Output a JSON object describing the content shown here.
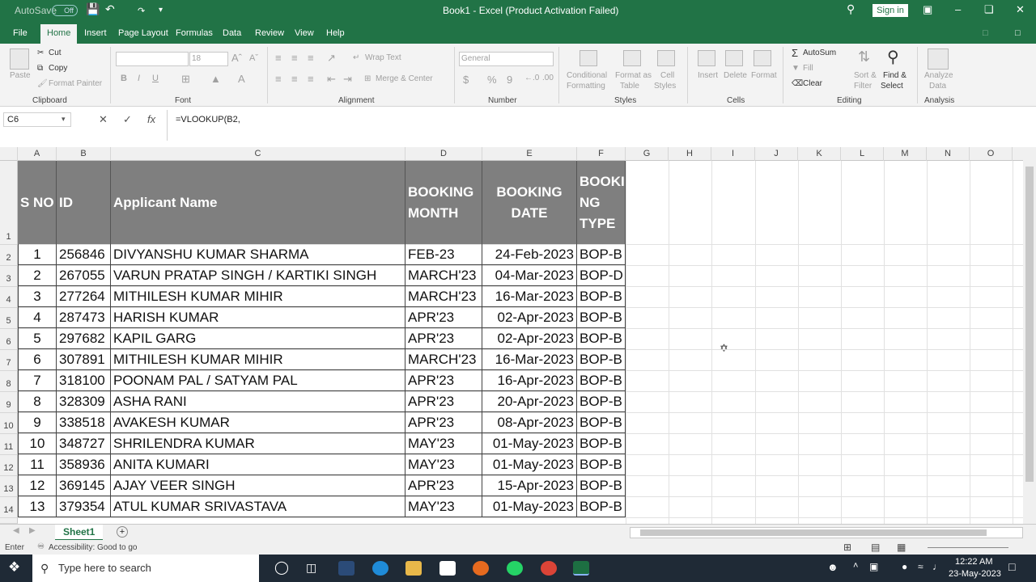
{
  "titlebar": {
    "autosave": "AutoSave",
    "autosave_state": "Off",
    "title": "Book1 - Excel (Product Activation Failed)",
    "sign_in": "Sign in"
  },
  "tabs": [
    "File",
    "Home",
    "Insert",
    "Page Layout",
    "Formulas",
    "Data",
    "Review",
    "View",
    "Help"
  ],
  "ribbon": {
    "clipboard": {
      "paste": "Paste",
      "cut": "Cut",
      "copy": "Copy",
      "format_painter": "Format Painter",
      "label": "Clipboard"
    },
    "font": {
      "name": "",
      "size": "18",
      "bold": "B",
      "italic": "I",
      "underline": "U",
      "label": "Font"
    },
    "alignment": {
      "wrap": "Wrap Text",
      "merge": "Merge & Center",
      "label": "Alignment"
    },
    "number": {
      "format": "General",
      "currency": "$",
      "percent": "%",
      "comma": "9",
      "label": "Number"
    },
    "styles": {
      "cond": "Conditional",
      "cond2": "Formatting",
      "table": "Format as",
      "table2": "Table",
      "cell": "Cell",
      "cell2": "Styles",
      "label": "Styles"
    },
    "cells": {
      "insert": "Insert",
      "delete": "Delete",
      "format": "Format",
      "label": "Cells"
    },
    "editing": {
      "autosum": "AutoSum",
      "fill": "Fill",
      "clear": "Clear",
      "sort": "Sort &",
      "sort2": "Filter",
      "find": "Find &",
      "find2": "Select",
      "label": "Editing"
    },
    "analysis": {
      "analyze": "Analyze",
      "analyze2": "Data",
      "label": "Analysis"
    }
  },
  "formula_bar": {
    "name_box": "C6",
    "formula": "=VLOOKUP(B2,"
  },
  "columns": [
    "A",
    "B",
    "C",
    "D",
    "E",
    "F",
    "G",
    "H",
    "I",
    "J",
    "K",
    "L",
    "M",
    "N",
    "O"
  ],
  "header": {
    "sno": "S NO",
    "id": "ID",
    "name": "Applicant Name",
    "month1": "BOOKING",
    "month2": "MONTH",
    "date1": "BOOKING",
    "date2": "DATE",
    "type1": "BOOKI",
    "type2": "NG",
    "type3": "TYPE"
  },
  "rows": [
    {
      "sno": "1",
      "id": "256846",
      "name": "DIVYANSHU KUMAR SHARMA",
      "month": "FEB-23",
      "date": "24-Feb-2023",
      "type": "BOP-B"
    },
    {
      "sno": "2",
      "id": "267055",
      "name": "VARUN PRATAP SINGH / KARTIKI SINGH",
      "month": "MARCH'23",
      "date": "04-Mar-2023",
      "type": "BOP-D"
    },
    {
      "sno": "3",
      "id": "277264",
      "name": "MITHILESH KUMAR MIHIR",
      "month": "MARCH'23",
      "date": "16-Mar-2023",
      "type": "BOP-B"
    },
    {
      "sno": "4",
      "id": "287473",
      "name": "HARISH KUMAR",
      "month": "APR'23",
      "date": "02-Apr-2023",
      "type": "BOP-B"
    },
    {
      "sno": "5",
      "id": "297682",
      "name": "KAPIL GARG",
      "month": "APR'23",
      "date": "02-Apr-2023",
      "type": "BOP-B"
    },
    {
      "sno": "6",
      "id": "307891",
      "name": "MITHILESH KUMAR MIHIR",
      "month": "MARCH'23",
      "date": "16-Mar-2023",
      "type": "BOP-B"
    },
    {
      "sno": "7",
      "id": "318100",
      "name": "POONAM PAL / SATYAM PAL",
      "month": "APR'23",
      "date": "16-Apr-2023",
      "type": "BOP-B"
    },
    {
      "sno": "8",
      "id": "328309",
      "name": "ASHA RANI",
      "month": "APR'23",
      "date": "20-Apr-2023",
      "type": "BOP-B"
    },
    {
      "sno": "9",
      "id": "338518",
      "name": "AVAKESH KUMAR",
      "month": "APR'23",
      "date": "08-Apr-2023",
      "type": "BOP-B"
    },
    {
      "sno": "10",
      "id": "348727",
      "name": "SHRILENDRA KUMAR",
      "month": "MAY'23",
      "date": "01-May-2023",
      "type": "BOP-B"
    },
    {
      "sno": "11",
      "id": "358936",
      "name": "ANITA KUMARI",
      "month": "MAY'23",
      "date": "01-May-2023",
      "type": "BOP-B"
    },
    {
      "sno": "12",
      "id": "369145",
      "name": "AJAY VEER SINGH",
      "month": "APR'23",
      "date": "15-Apr-2023",
      "type": "BOP-B"
    },
    {
      "sno": "13",
      "id": "379354",
      "name": "ATUL KUMAR SRIVASTAVA",
      "month": "MAY'23",
      "date": "01-May-2023",
      "type": "BOP-B"
    }
  ],
  "sheet_tab": "Sheet1",
  "status": {
    "mode": "Enter",
    "accessibility": "Accessibility: Good to go"
  },
  "taskbar": {
    "search": "Type here to search",
    "time": "12:22 AM",
    "date": "23-May-2023"
  }
}
